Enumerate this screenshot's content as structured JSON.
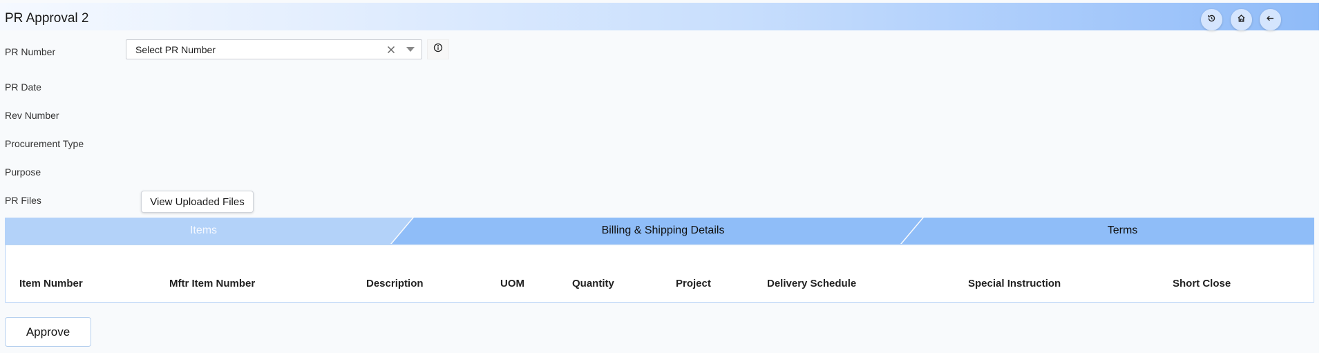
{
  "header": {
    "title": "PR Approval 2",
    "buttons": [
      {
        "icon": "history-icon"
      },
      {
        "icon": "home-icon"
      },
      {
        "icon": "back-arrow-icon"
      }
    ]
  },
  "form": {
    "pr_number_label": "PR Number",
    "pr_number_placeholder": "Select PR Number",
    "pr_date_label": "PR Date",
    "rev_number_label": "Rev Number",
    "procurement_type_label": "Procurement Type",
    "purpose_label": "Purpose",
    "pr_files_label": "PR Files",
    "view_files_label": "View Uploaded Files"
  },
  "tabs": [
    {
      "label": "Items",
      "active": true
    },
    {
      "label": "Billing & Shipping Details",
      "active": false
    },
    {
      "label": "Terms",
      "active": false
    }
  ],
  "table": {
    "columns": [
      "Item Number",
      "Mftr Item Number",
      "Description",
      "UOM",
      "Quantity",
      "Project",
      "Delivery Schedule",
      "Special Instruction",
      "Short Close"
    ]
  },
  "actions": {
    "approve_label": "Approve"
  },
  "colors": {
    "header_gradient_start": "#f5f9ff",
    "header_gradient_end": "#8fbbf8",
    "tab_active": "#b3d2f9",
    "tab_inactive": "#8fbdf8",
    "border": "#b7d3f6"
  }
}
